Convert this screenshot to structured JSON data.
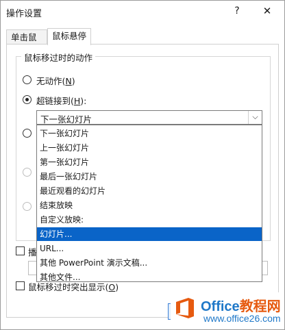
{
  "window": {
    "title": "操作设置",
    "help_glyph": "?",
    "close_glyph": "✕"
  },
  "tabs": [
    {
      "label": "单击鼠标"
    },
    {
      "label": "鼠标悬停"
    }
  ],
  "group": {
    "label": "鼠标移过时的动作"
  },
  "options": {
    "none": {
      "label": "无动作(",
      "key": "N",
      "tail": ")"
    },
    "hyperlink": {
      "label": "超链接到(",
      "key": "H",
      "tail": "):"
    }
  },
  "hyperlink_combo": {
    "value": "下一张幻灯片",
    "arrow": "⌵"
  },
  "dropdown": {
    "items": [
      "下一张幻灯片",
      "上一张幻灯片",
      "第一张幻灯片",
      "最后一张幻灯片",
      "最近观看的幻灯片",
      "结束放映",
      "自定义放映:",
      "幻灯片...",
      "URL...",
      "其他 PowerPoint 演示文稿...",
      "其他文件..."
    ],
    "selected_index": 7
  },
  "sound": {
    "label_partial": "播"
  },
  "highlight": {
    "label": "鼠标移过时突出显示(",
    "key": "O",
    "tail": ")"
  },
  "buttons": {
    "ok_partial": "定",
    "cancel_partial": "取消"
  },
  "watermark": {
    "line1_en": "Office",
    "line1_cn": "教程网",
    "line2": "www.office26.com",
    "colors": {
      "blue": "#1f78c8",
      "orange": "#e65a10"
    }
  },
  "colors": {
    "selection": "#0a64c8"
  }
}
